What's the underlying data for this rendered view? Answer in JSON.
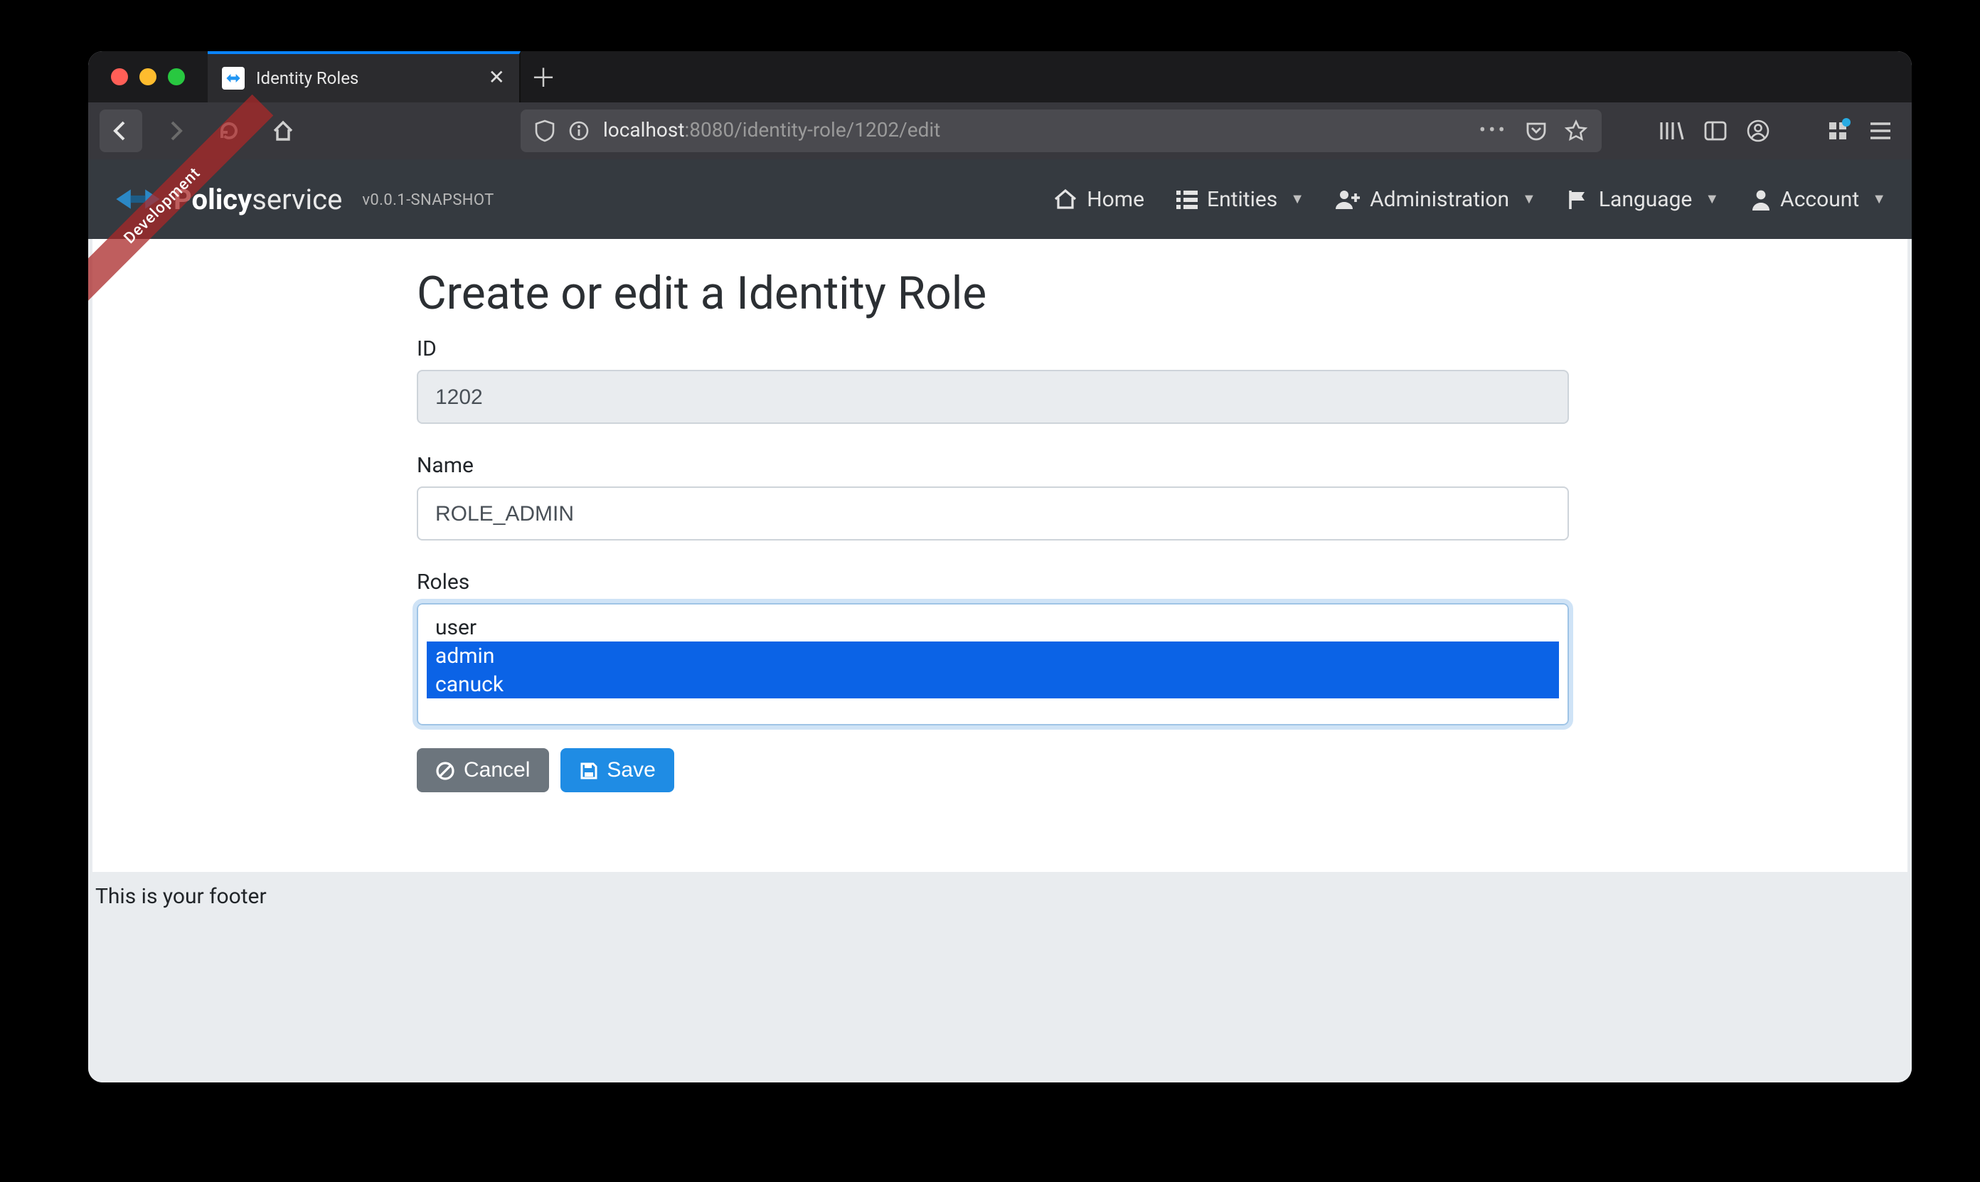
{
  "browser": {
    "tab_title": "Identity Roles",
    "url_prefix": "localhost",
    "url_port": ":8080",
    "url_path": "/identity-role/1202/edit"
  },
  "ribbon": {
    "label": "Development"
  },
  "brand": {
    "name_bold": "Policy",
    "name_light": "service",
    "version": "v0.0.1-SNAPSHOT"
  },
  "nav": {
    "home": "Home",
    "entities": "Entities",
    "administration": "Administration",
    "language": "Language",
    "account": "Account"
  },
  "form": {
    "heading": "Create or edit a Identity Role",
    "id_label": "ID",
    "id_value": "1202",
    "name_label": "Name",
    "name_value": "ROLE_ADMIN",
    "roles_label": "Roles",
    "roles_options": [
      {
        "label": "user",
        "selected": false
      },
      {
        "label": "admin",
        "selected": true
      },
      {
        "label": "canuck",
        "selected": true
      }
    ],
    "cancel_label": "Cancel",
    "save_label": "Save"
  },
  "footer_text": "This is your footer"
}
